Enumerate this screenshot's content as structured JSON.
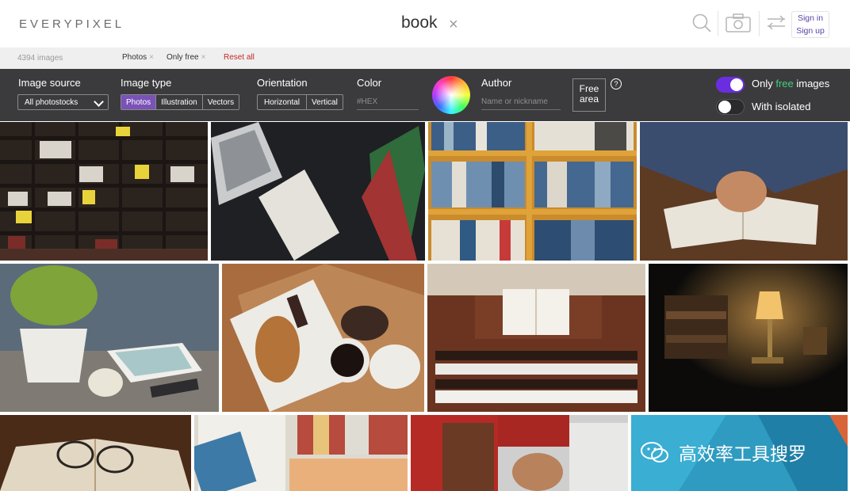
{
  "header": {
    "logo": "EVERYPIXEL",
    "query": "book",
    "clear_glyph": "×",
    "sign_in": "Sign in",
    "sign_up": "Sign up",
    "icons": [
      "search-icon",
      "camera-icon",
      "filter-sliders-icon"
    ]
  },
  "summary": {
    "count": "4394 images",
    "chips": [
      "Photos",
      "Only free"
    ],
    "chip_remove": "×",
    "reset": "Reset all"
  },
  "filters": {
    "image_source": {
      "label": "Image source",
      "value": "All photostocks"
    },
    "image_type": {
      "label": "Image type",
      "options": [
        "Photos",
        "Illustration",
        "Vectors"
      ],
      "selected": "Photos"
    },
    "orientation": {
      "label": "Orientation",
      "options": [
        "Horizontal",
        "Vertical"
      ]
    },
    "color": {
      "label": "Color",
      "placeholder": "#HEX"
    },
    "author": {
      "label": "Author",
      "placeholder": "Name or nickname"
    },
    "free_area": {
      "line1": "Free",
      "line2": "area",
      "help": "?"
    },
    "only_free": {
      "before": "Only ",
      "free": "free",
      "after": " images",
      "on": true
    },
    "with_isolated": {
      "label": "With isolated",
      "on": false
    }
  },
  "watermark": "高效率工具搜罗",
  "colors": {
    "accent": "#6a2ee0",
    "panel": "#3b3b3d",
    "free_green": "#3fd27a",
    "reset_red": "#c22a2a"
  }
}
